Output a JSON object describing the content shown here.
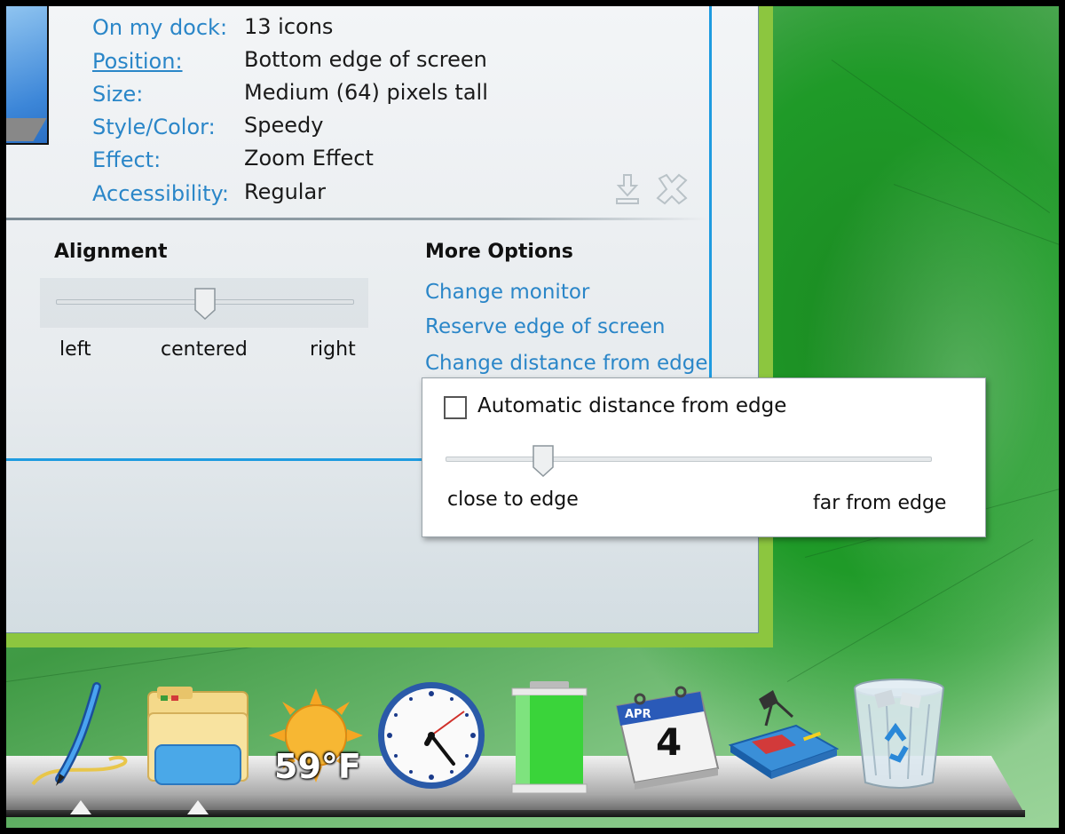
{
  "info": {
    "rows": [
      {
        "label": "On my dock:",
        "value": "13 icons"
      },
      {
        "label": "Position:",
        "value": "Bottom edge of screen"
      },
      {
        "label": "Size:",
        "value": "Medium (64) pixels tall"
      },
      {
        "label": "Style/Color:",
        "value": "Speedy"
      },
      {
        "label": "Effect:",
        "value": "Zoom Effect"
      },
      {
        "label": "Accessibility:",
        "value": "Regular"
      }
    ]
  },
  "alignment": {
    "title": "Alignment",
    "labels": {
      "left": "left",
      "center": "centered",
      "right": "right"
    },
    "value_fraction": 0.5
  },
  "more_options": {
    "title": "More Options",
    "links": [
      "Change monitor",
      "Reserve edge of screen",
      "Change distance from edge"
    ]
  },
  "distance_popup": {
    "checkbox_label": "Automatic distance from edge",
    "checked": false,
    "labels": {
      "min": "close to edge",
      "max": "far from edge"
    },
    "value_fraction": 0.2
  },
  "dock": {
    "weather": "59°F",
    "calendar_month": "APR",
    "calendar_day": "4",
    "icons": [
      "pen-icon",
      "folder-icon",
      "weather-sun-icon",
      "clock-icon",
      "battery-icon",
      "calendar-icon",
      "desk-lamp-icon",
      "recycle-bin-icon"
    ]
  },
  "colors": {
    "link": "#2a86c8",
    "accent_green": "#8cc63f",
    "accent_blue": "#1e9be0"
  }
}
